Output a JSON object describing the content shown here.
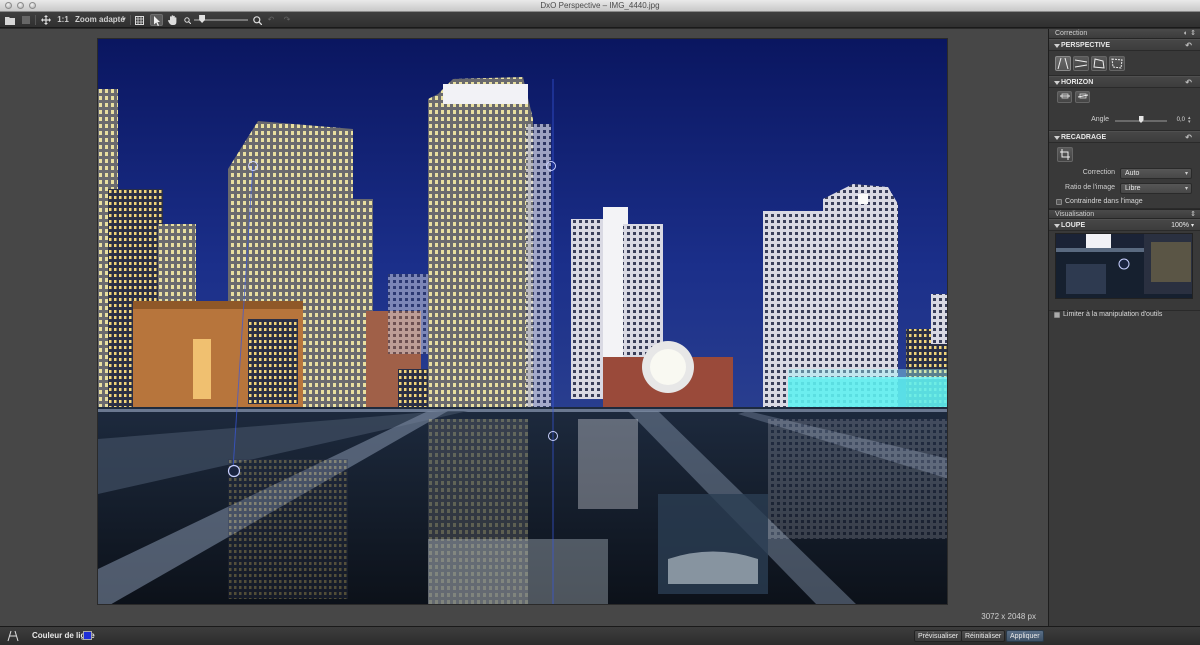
{
  "window": {
    "title": "DxO Perspective – IMG_4440.jpg"
  },
  "toolbar": {
    "ratio_label": "1:1",
    "zoom_label": "Zoom adapté",
    "zoom_level": 0.15
  },
  "canvas": {
    "image_size": "3072 x 2048 px"
  },
  "panel": {
    "header": "Correction",
    "perspective": {
      "title": "PERSPECTIVE"
    },
    "horizon": {
      "title": "HORIZON",
      "angle_label": "Angle",
      "angle_value": "0,0",
      "angle_fraction": 0.5
    },
    "recadrage": {
      "title": "RECADRAGE",
      "correction_label": "Correction",
      "correction_value": "Auto",
      "ratio_label": "Ratio de l'image",
      "ratio_value": "Libre",
      "constrain_label": "Contraindre dans l'image"
    },
    "visualisation": {
      "header": "Visualisation",
      "loupe_title": "LOUPE",
      "loupe_zoom": "100%",
      "limit_label": "Limiter à la manipulation d'outils"
    }
  },
  "bottombar": {
    "line_color_label": "Couleur de ligne",
    "line_color": "#1f2fd8",
    "preview_label": "Prévisualiser",
    "reset_label": "Réinitialiser",
    "apply_label": "Appliquer"
  },
  "icons": [
    "folder-icon",
    "export-icon",
    "move-icon",
    "grid-icon",
    "pointer-icon",
    "hand-icon",
    "zoom-out-icon",
    "zoom-in-icon",
    "undo-icon",
    "redo-icon",
    "perspective-tool-icon"
  ]
}
